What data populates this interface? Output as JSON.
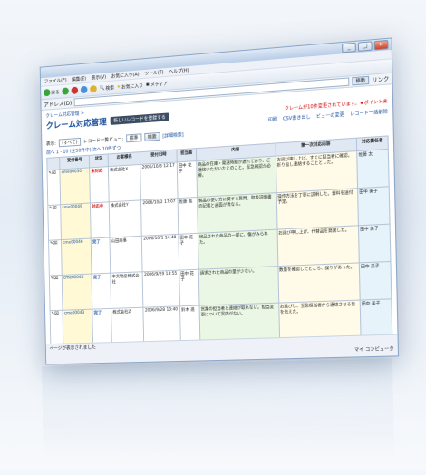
{
  "window": {
    "controls": [
      "_",
      "□",
      "✕"
    ],
    "menu": [
      "ファイル(F)",
      "編集(E)",
      "表示(V)",
      "お気に入り(A)",
      "ツール(T)",
      "ヘルプ(H)"
    ],
    "toolbar": [
      "戻る",
      "検索",
      "お気に入り",
      "メディア"
    ],
    "address_label": "アドレス(D)",
    "address_value": "",
    "go_label": "移動",
    "links_label": "リンク"
  },
  "page": {
    "breadcrumb": "クレーム対応管理 >",
    "title": "クレーム対応管理",
    "add_button": "新しいレコードを登録する",
    "notice": "クレームが10件変更されています。★ポイント未",
    "actions": [
      "印刷",
      "CSV書き出し",
      "ビューの変更",
      "レコード一括削除"
    ],
    "filter_label": "表示:",
    "filter_value": "(すべて)",
    "record_label": "レコード一覧ビュー:",
    "record_value": "標準",
    "search_button": "検索",
    "adv_search": "[詳細検索]",
    "pager": "前へ 1 - 10 (全50件中) 次へ 10件ずつ"
  },
  "table": {
    "headers": [
      "",
      "受付番号",
      "状況",
      "お客様名",
      "受付日時",
      "担当者",
      "内容",
      "第一次対応内容",
      "対応責任者"
    ],
    "rows": [
      {
        "id": "cme00050",
        "status": "未対応",
        "status_kind": "hold",
        "customer": "株式会社X",
        "date": "2006/10/3 12:17",
        "staff": "田中 花子",
        "content": "商品の在庫・発送時期が遅れており、ご連絡いただいたとのこと。至急確認が必要。",
        "response": "お詫び申し上げ、すぐに担当者に確認。折り返し連絡することとした。",
        "owner": "佐藤 太"
      },
      {
        "id": "cme00049",
        "status": "対応中",
        "status_kind": "hold",
        "customer": "株式会社Y",
        "date": "2006/10/2 17:07",
        "staff": "佐藤 進",
        "content": "製品の使い方に関する質問。取扱説明書の記載と画面が異なる。",
        "response": "操作方法を丁寧に説明した。資料を送付予定。",
        "owner": "田中 美子"
      },
      {
        "id": "cme00046",
        "status": "完了",
        "status_kind": "done",
        "customer": "山田商事",
        "date": "2006/10/1 14:48",
        "staff": "田中 花子",
        "content": "納品された商品の一部に、傷がみられた。",
        "response": "お詫び申し上げ、代替品を発送した。",
        "owner": "田中 美子"
      },
      {
        "id": "cme00045",
        "status": "完了",
        "status_kind": "done",
        "customer": "中央物産株式会社",
        "date": "2006/9/29 13:55",
        "staff": "田中 花子",
        "content": "請求された商品の量が少ない。",
        "response": "数量を確認したところ、誤りがあった。",
        "owner": "田中 美子"
      },
      {
        "id": "cme00043",
        "status": "完了",
        "status_kind": "done",
        "customer": "株式会社Z",
        "date": "2006/9/28 10:40",
        "staff": "鈴木 進",
        "content": "営業の担当者と連絡が取れない。担当変更について案内がない。",
        "response": "お詫びし、至急担当者から連絡させる旨を伝えた。",
        "owner": "田中 美子"
      }
    ]
  },
  "statusbar": {
    "page_status": "ページが表示されました",
    "zone": "マイ コンピュータ"
  },
  "colors": {
    "accent": "#1a4fa0",
    "hold": "#d11111",
    "content_bg": "#eaf7e4",
    "id_bg": "#fff9d6"
  }
}
